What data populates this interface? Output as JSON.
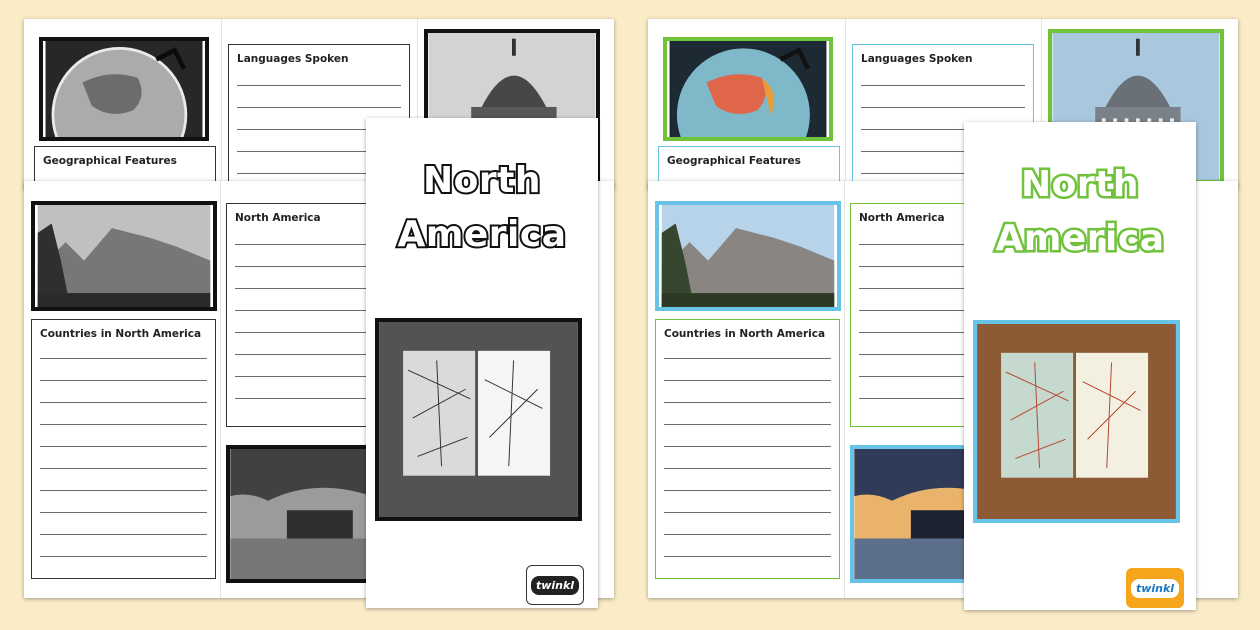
{
  "colors": {
    "background": "#fbecc8",
    "color_border_green": "#6fc23a",
    "color_border_blue": "#67c4e6",
    "logo_orange": "#f7a51c"
  },
  "brand": {
    "logo_text": "twinkl"
  },
  "cover": {
    "title_line1": "North",
    "title_line2": "America"
  },
  "sections": {
    "languages": "Languages Spoken",
    "geography": "Geographical Features",
    "north_america": "North America",
    "countries": "Countries in North America"
  },
  "variants": [
    "black-and-white",
    "colour"
  ],
  "images": [
    "globe",
    "capitol-building",
    "mount-rushmore",
    "road-atlas",
    "city-skyline-sunset"
  ]
}
